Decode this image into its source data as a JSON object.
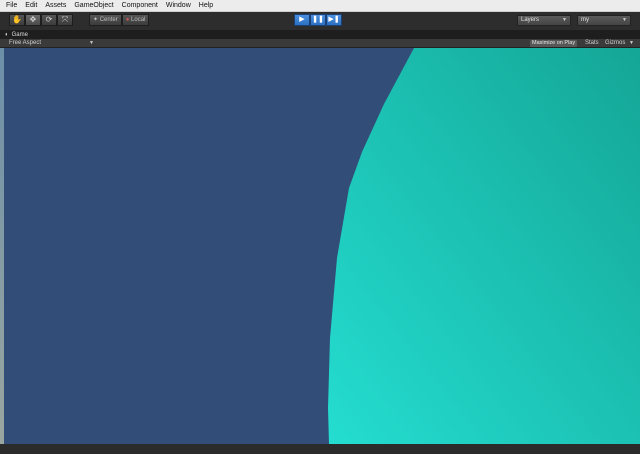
{
  "menubar": {
    "items": [
      "File",
      "Edit",
      "Assets",
      "GameObject",
      "Component",
      "Window",
      "Help"
    ]
  },
  "toolbar": {
    "transform_tools": [
      "hand-icon",
      "move-icon",
      "rotate-icon",
      "scale-icon"
    ],
    "pivot_center_label": "Center",
    "pivot_local_label": "Local",
    "playback": [
      "play-icon",
      "pause-icon",
      "step-icon"
    ],
    "layers_label": "Layers",
    "layout_label": "my"
  },
  "game_view": {
    "tab_label": "Game",
    "aspect_label": "Free Aspect",
    "maximize_label": "Maximize on Play",
    "stats_label": "Stats",
    "gizmos_label": "Gizmos"
  },
  "colors": {
    "background": "#314d78",
    "sphere_light": "#24ddd0",
    "sphere_dark": "#14a696",
    "play_accent": "#2d6fc0"
  }
}
